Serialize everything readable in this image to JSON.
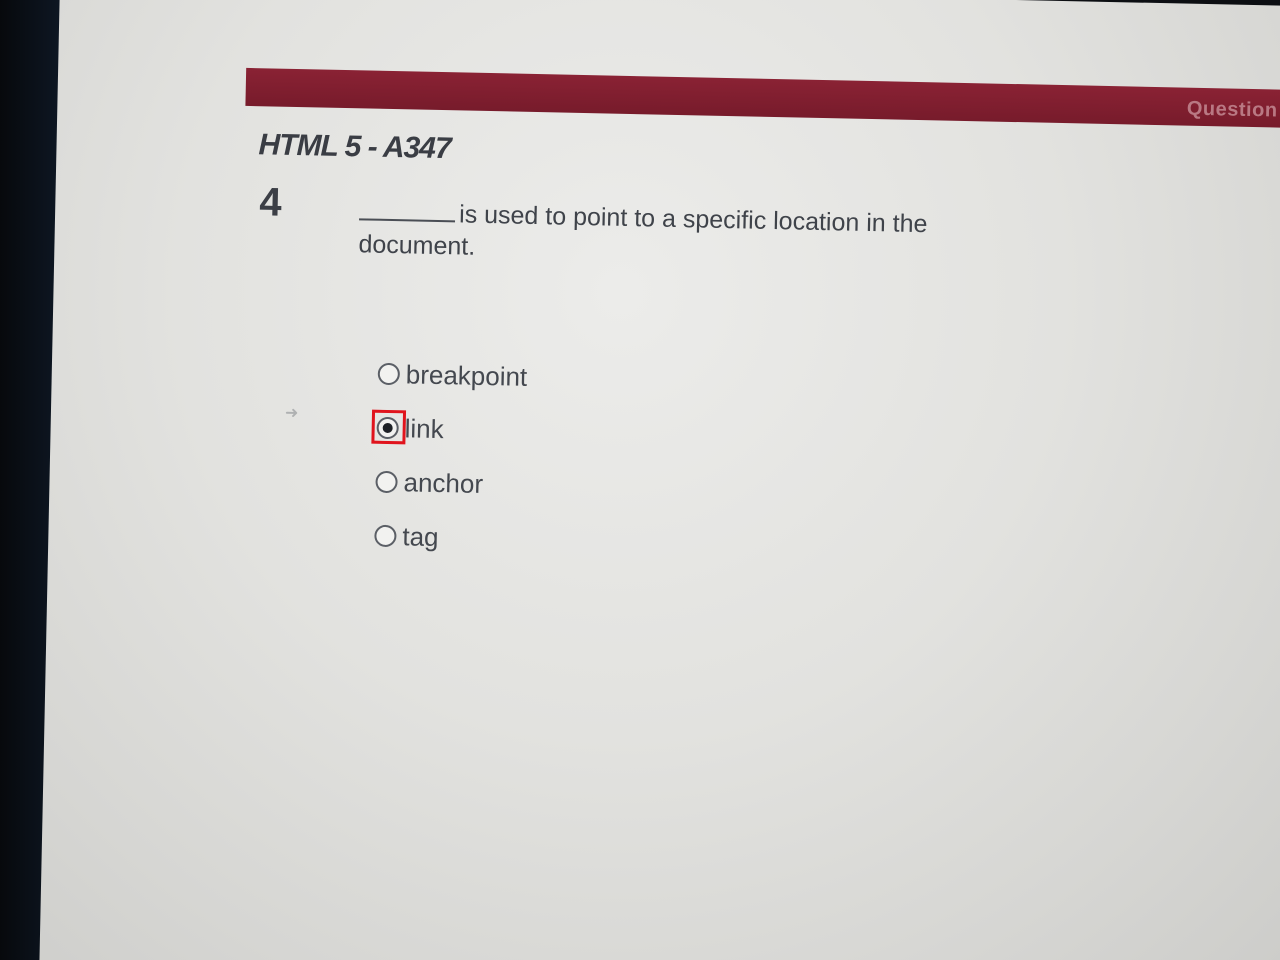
{
  "header": {
    "right_label": "Question",
    "bar_color": "#7f1d2e"
  },
  "exam": {
    "title": "HTML 5 - A347"
  },
  "question": {
    "number": "4",
    "text": "is used to point to a specific location in the document."
  },
  "options": [
    {
      "label": "breakpoint",
      "selected": false
    },
    {
      "label": "link",
      "selected": true
    },
    {
      "label": "anchor",
      "selected": false
    },
    {
      "label": "tag",
      "selected": false
    }
  ],
  "highlight_color": "#e0141d"
}
